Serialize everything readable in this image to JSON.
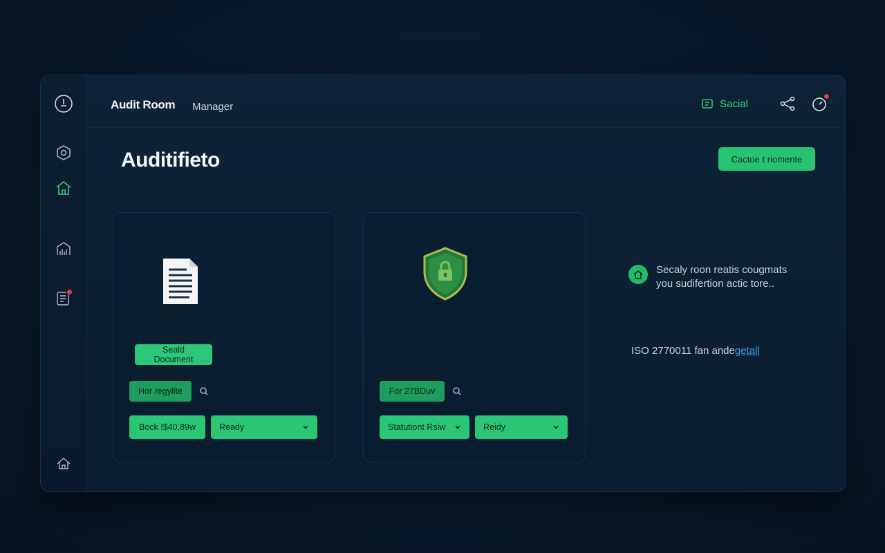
{
  "header": {
    "app_title": "Audit Room",
    "app_subtitle": "Manager",
    "social_label": "Sacial"
  },
  "sidebar": {
    "items": [
      {
        "icon": "clock-icon"
      },
      {
        "icon": "settings-hex-icon"
      },
      {
        "icon": "home-icon",
        "active": true
      },
      {
        "icon": "analytics-icon"
      },
      {
        "icon": "documents-icon",
        "badge": true
      },
      {
        "icon": "home-outline-icon"
      }
    ]
  },
  "main": {
    "page_title": "Auditifieto",
    "primary_button": "Cactoe t riomente"
  },
  "cards": [
    {
      "icon": "document-icon",
      "seal_button": "Seald Document",
      "tag_button": "Hor regylite",
      "action_button": "Bock !$40,89w",
      "status_select": "Ready"
    },
    {
      "icon": "shield-lock-icon",
      "tag_button": "For 27BDuv",
      "action_button": "Statutiont Rsiw",
      "status_select": "Reidy"
    }
  ],
  "info": {
    "line1": "Secaly roon reatis cougmats",
    "line2": "you sudifertion actic tore..",
    "iso_prefix": "ISO 2770011 fan ande",
    "iso_link": "getall"
  },
  "colors": {
    "accent": "#28c273",
    "background": "#0a1a2c",
    "link": "#3b9ee8",
    "badge": "#e53e4a"
  }
}
